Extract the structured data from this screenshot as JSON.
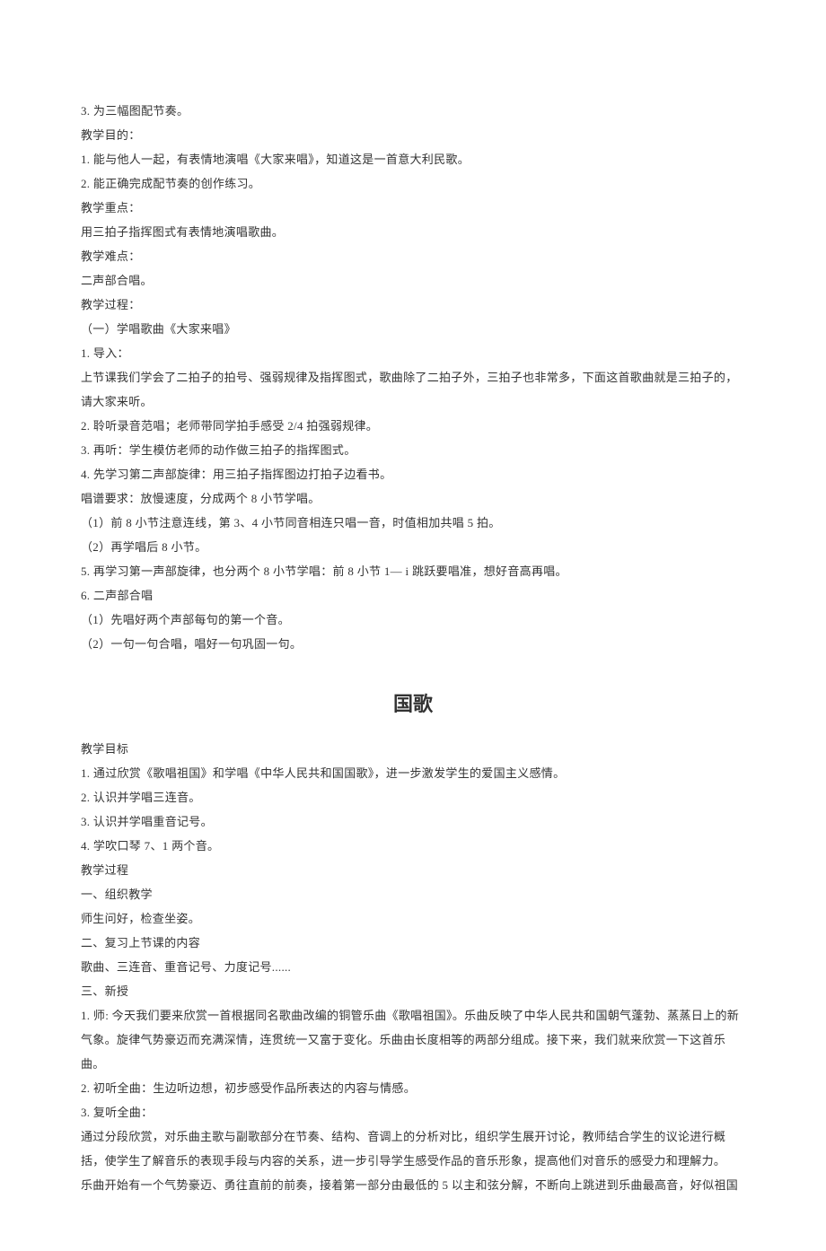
{
  "section1": {
    "lines": [
      "3. 为三幅图配节奏。",
      "教学目的：",
      "1. 能与他人一起，有表情地演唱《大家来唱》，知道这是一首意大利民歌。",
      "2. 能正确完成配节奏的创作练习。",
      "教学重点：",
      "用三拍子指挥图式有表情地演唱歌曲。",
      "教学难点：",
      "二声部合唱。",
      "教学过程：",
      "（一）学唱歌曲《大家来唱》",
      "1. 导入：",
      "上节课我们学会了二拍子的拍号、强弱规律及指挥图式，歌曲除了二拍子外，三拍子也非常多，下面这首歌曲就是三拍子的，请大家来听。",
      "2. 聆听录音范唱；老师带同学拍手感受 2/4 拍强弱规律。",
      "3. 再听：学生模仿老师的动作做三拍子的指挥图式。",
      "4. 先学习第二声部旋律：用三拍子指挥图边打拍子边看书。",
      "唱谱要求：放慢速度，分成两个 8 小节学唱。",
      "（1）前 8 小节注意连线，第 3、4 小节同音相连只唱一音，时值相加共唱 5 拍。",
      "（2）再学唱后 8 小节。",
      "5. 再学习第一声部旋律，也分两个 8 小节学唱：前 8 小节 1— i 跳跃要唱准，想好音高再唱。",
      "6. 二声部合唱",
      "（1）先唱好两个声部每句的第一个音。",
      "（2）一句一句合唱，唱好一句巩固一句。"
    ]
  },
  "section2": {
    "title": "国歌",
    "lines": [
      "教学目标",
      "1. 通过欣赏《歌唱祖国》和学唱《中华人民共和国国歌》，进一步激发学生的爱国主义感情。",
      "2. 认识并学唱三连音。",
      "3. 认识并学唱重音记号。",
      "4. 学吹口琴 7、1 两个音。",
      "教学过程",
      "一、组织教学",
      "师生问好，检查坐姿。",
      "二、复习上节课的内容",
      "歌曲、三连音、重音记号、力度记号......",
      "三、新授",
      "1. 师: 今天我们要来欣赏一首根据同名歌曲改编的铜管乐曲《歌唱祖国》。乐曲反映了中华人民共和国朝气蓬勃、蒸蒸日上的新气象。旋律气势豪迈而充满深情，连贯统一又富于变化。乐曲由长度相等的两部分组成。接下来，我们就来欣赏一下这首乐曲。",
      "2. 初听全曲：生边听边想，初步感受作品所表达的内容与情感。",
      "3. 复听全曲：",
      "通过分段欣赏，对乐曲主歌与副歌部分在节奏、结构、音调上的分析对比，组织学生展开讨论，教师结合学生的议论进行概括，使学生了解音乐的表现手段与内容的关系，进一步引导学生感受作品的音乐形象，提高他们对音乐的感受力和理解力。",
      "乐曲开始有一个气势豪迈、勇往直前的前奏，接着第一部分由最低的 5 以主和弦分解，不断向上跳进到乐曲最高音，好似祖国"
    ]
  }
}
